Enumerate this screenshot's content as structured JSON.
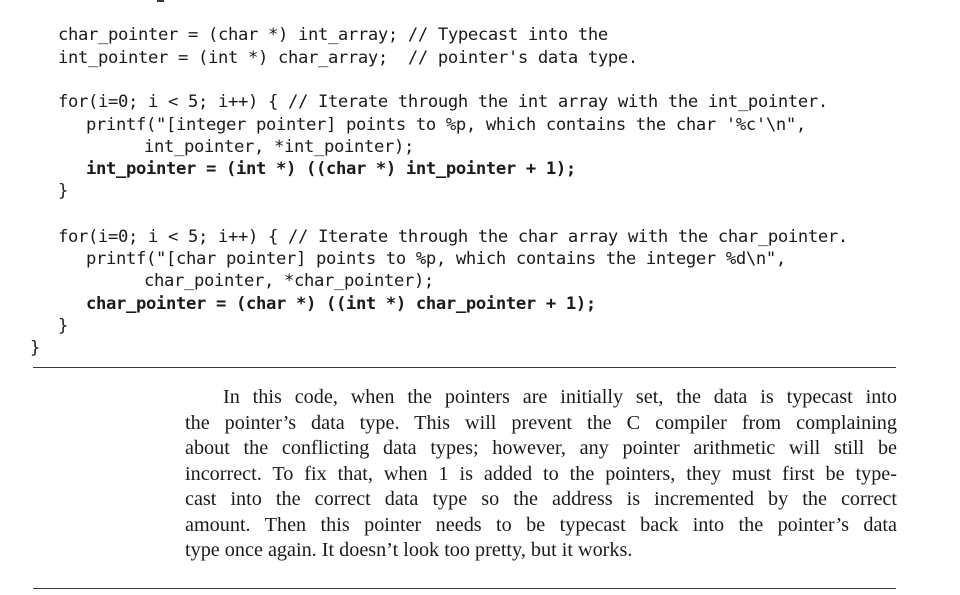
{
  "code": {
    "lines": [
      "char_pointer = (char *) int_array; // Typecast into the",
      "int_pointer = (int *) char_array;  // pointer's data type.",
      "for(i=0; i < 5; i++) { // Iterate through the int array with the int_pointer.",
      "printf(\"[integer pointer] points to %p, which contains the char '%c'\\n\",",
      "int_pointer, *int_pointer);",
      "int_pointer = (int *) ((char *) int_pointer + 1);",
      "}",
      "for(i=0; i < 5; i++) { // Iterate through the char array with the char_pointer.",
      "printf(\"[char pointer] points to %p, which contains the integer %d\\n\",",
      "char_pointer, *char_pointer);",
      "char_pointer = (char *) ((int *) char_pointer + 1);",
      "}",
      "}"
    ]
  },
  "prose": {
    "lines": [
      "In this code, when the pointers are initially set, the data is typecast into",
      "the pointer’s data type. This will prevent the C compiler from complaining",
      "about the conflicting data types; however, any pointer arithmetic will still be",
      "incorrect. To fix that, when 1 is added to the pointers, they must first be type-",
      "cast into the correct data type so the address is incremented by the correct",
      "amount. Then this pointer needs to be typecast back into the pointer’s data",
      "type once again. It doesn’t look too pretty, but it works."
    ]
  }
}
